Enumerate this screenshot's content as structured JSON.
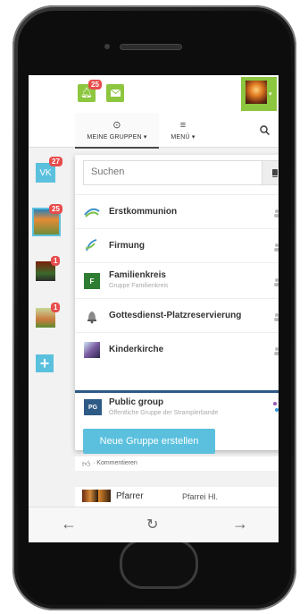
{
  "topbar": {
    "notification_badge": "25",
    "colors": {
      "accent_green": "#8dc63f",
      "badge_red": "#e74c4c",
      "accent_blue": "#5bc0de"
    }
  },
  "navbar": {
    "my_groups_label": "MEINE GRUPPEN ▾",
    "menu_label": "MENÜ ▾"
  },
  "sidebar": {
    "items": [
      {
        "label": "VK",
        "badge": "27"
      },
      {
        "badge": "25"
      },
      {
        "badge": "1"
      },
      {
        "badge": "1"
      }
    ]
  },
  "dropdown": {
    "search_placeholder": "Suchen",
    "groups": [
      {
        "title": "Erstkommunion",
        "subtitle": ""
      },
      {
        "title": "Firmung",
        "subtitle": ""
      },
      {
        "title": "Familienkreis",
        "subtitle": "Gruppe Familienkreis",
        "icon_letter": "F"
      },
      {
        "title": "Gottesdienst-Platzreservierung",
        "subtitle": ""
      },
      {
        "title": "Kinderkirche",
        "subtitle": ""
      }
    ],
    "public_group": {
      "title": "Public group",
      "subtitle": "Öffentliche Gruppe der Stramplerbande",
      "icon_letter": "PG"
    },
    "create_button": "Neue Gruppe erstellen"
  },
  "feed": {
    "comment_label": "· Kommentieren",
    "post_author": "Pfarrer",
    "post_place": "Pfarrei Hl."
  }
}
